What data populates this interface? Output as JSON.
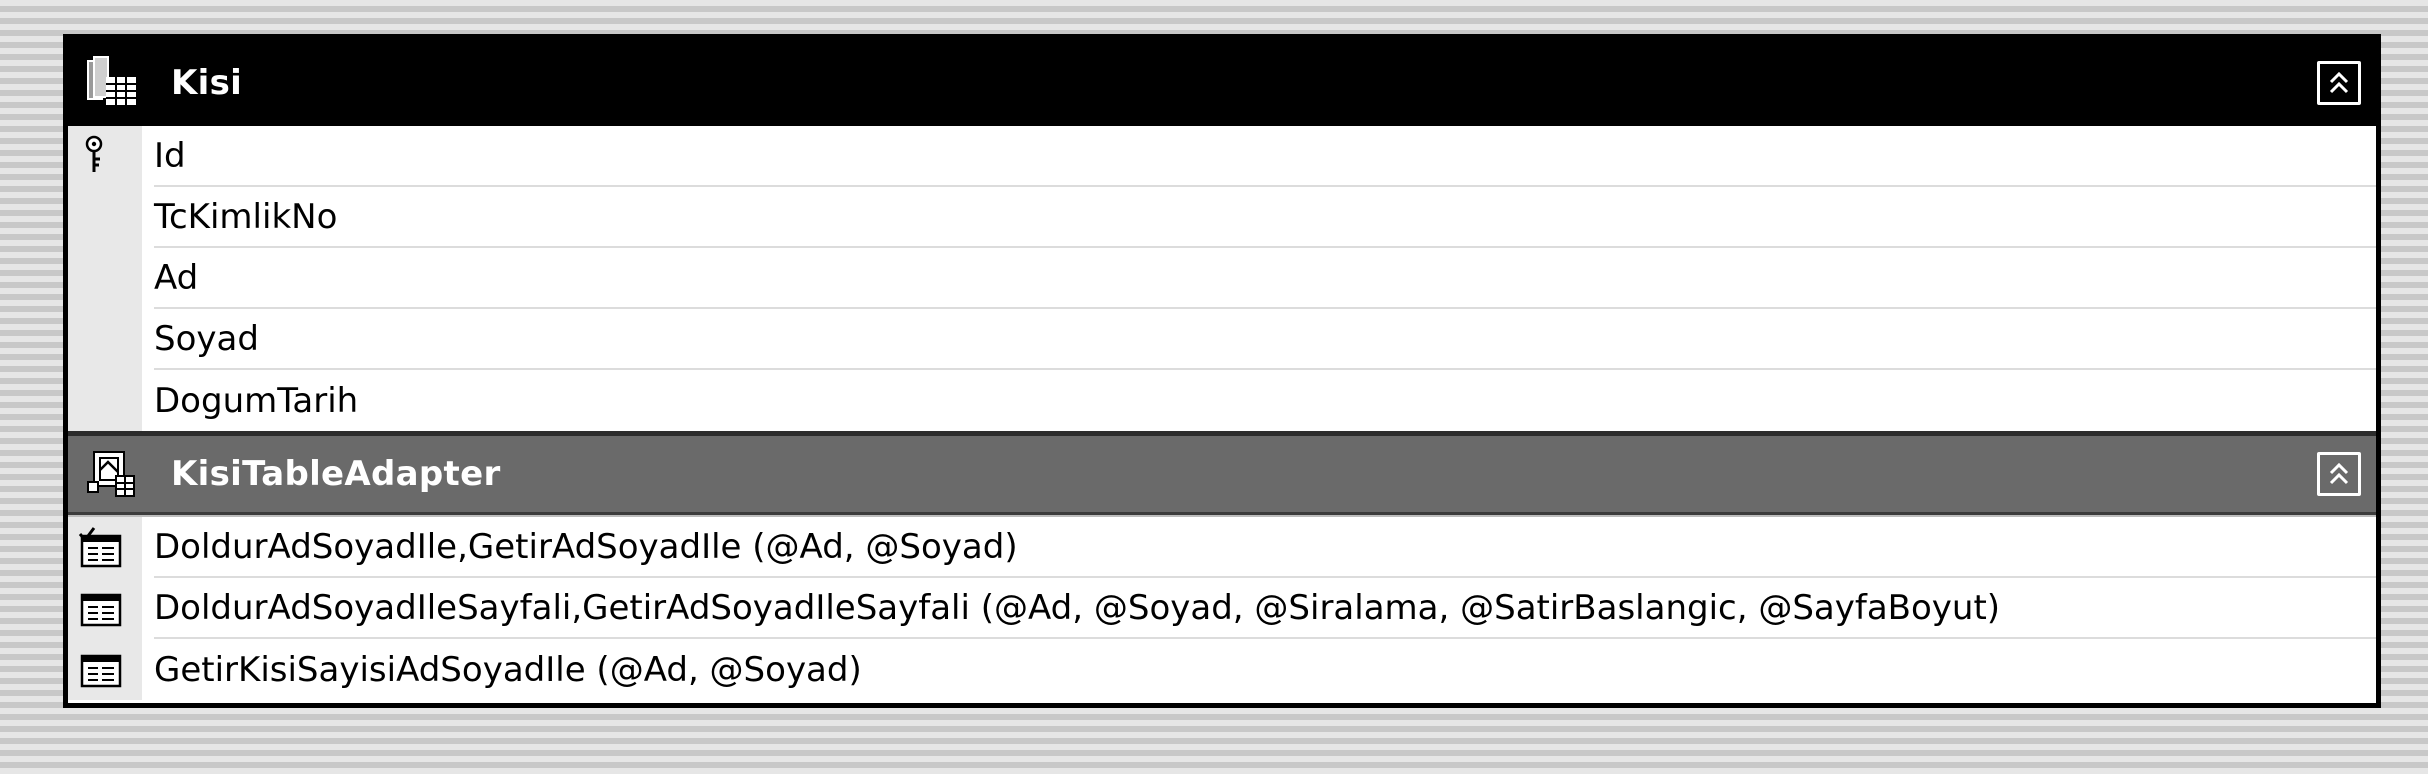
{
  "table": {
    "title": "Kisi",
    "icon": "datatable-icon",
    "columns": [
      {
        "label": "Id",
        "icon": "primary-key-icon"
      },
      {
        "label": "TcKimlikNo"
      },
      {
        "label": "Ad"
      },
      {
        "label": "Soyad"
      },
      {
        "label": "DogumTarih"
      }
    ]
  },
  "adapter": {
    "title": "KisiTableAdapter",
    "icon": "table-adapter-icon",
    "queries": [
      {
        "label": "DoldurAdSoyadIle,GetirAdSoyadIle (@Ad, @Soyad)",
        "icon": "query-default-icon"
      },
      {
        "label": "DoldurAdSoyadIleSayfali,GetirAdSoyadIleSayfali (@Ad, @Soyad, @Siralama, @SatirBaslangic, @SayfaBoyut)",
        "icon": "query-icon"
      },
      {
        "label": "GetirKisiSayisiAdSoyadIle (@Ad, @Soyad)",
        "icon": "query-icon"
      }
    ]
  },
  "colors": {
    "header_dark": "#000000",
    "header_gray": "#6a6a6a",
    "gutter": "#e8e8e8"
  }
}
